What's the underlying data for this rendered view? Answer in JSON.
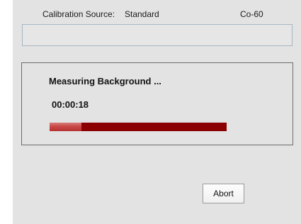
{
  "calibration": {
    "label": "Calibration Source:",
    "source": "Standard",
    "isotope": "Co-60",
    "info_text": ""
  },
  "measurement": {
    "title": "Measuring Background ...",
    "elapsed": "00:00:18",
    "progress_fraction": 0.18
  },
  "actions": {
    "abort_label": "Abort"
  },
  "colors": {
    "window_bg": "#e3e3e3",
    "progress_track": "#8b0000",
    "progress_fill": "#c94848",
    "field_border": "#a7b6c4"
  }
}
